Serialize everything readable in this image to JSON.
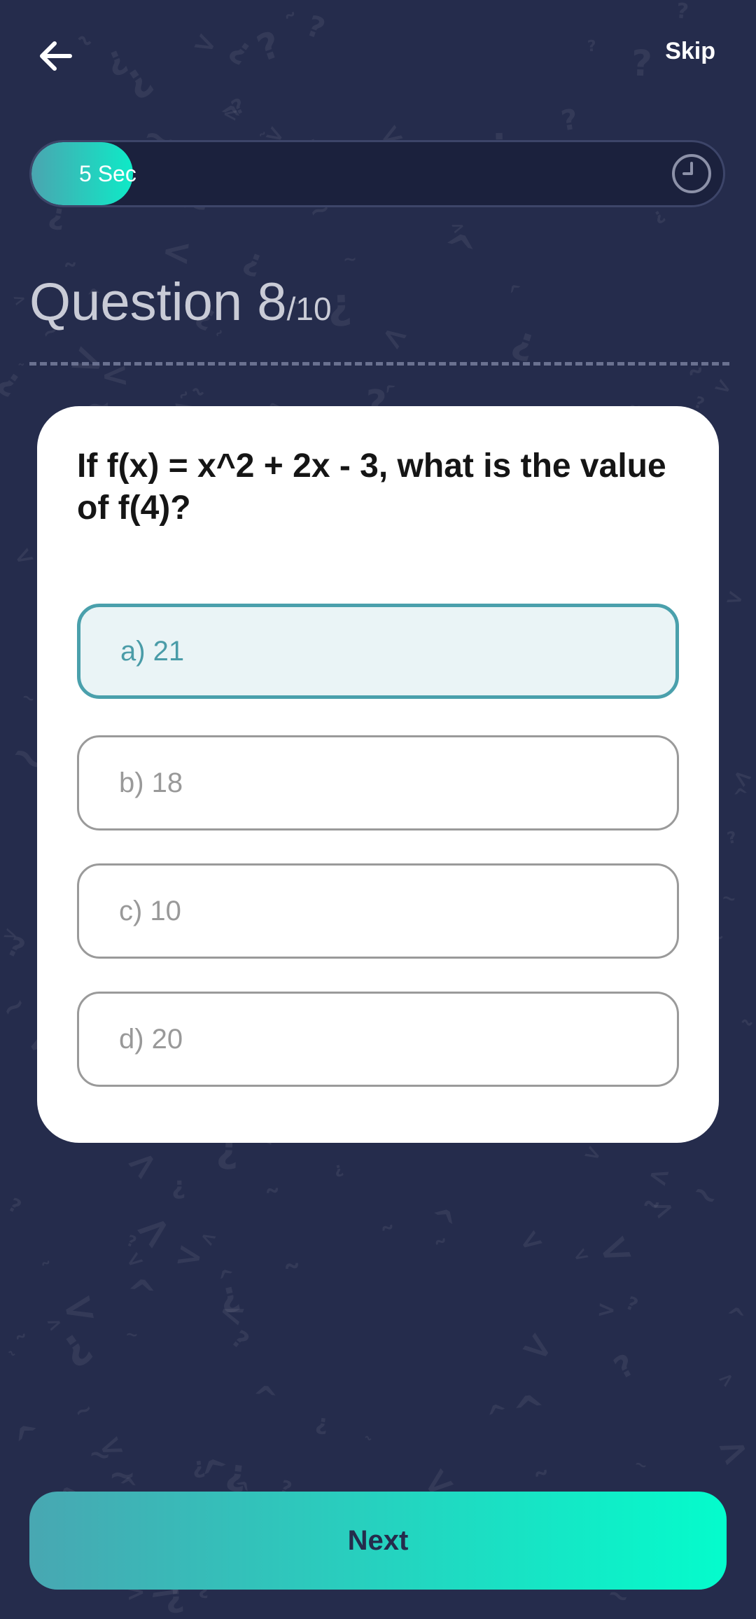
{
  "header": {
    "back_icon": "arrow-left-icon",
    "skip_label": "Skip"
  },
  "timer": {
    "label": "5 Sec",
    "icon": "clock-icon",
    "accent_start": "#4aa5b0",
    "accent_end": "#0eeac7"
  },
  "question": {
    "heading": "Question 8",
    "total": "/10",
    "text": "If f(x) = x^2 + 2x - 3, what is the value of f(4)?"
  },
  "options": [
    {
      "label": "a) 21",
      "selected": true
    },
    {
      "label": "b) 18",
      "selected": false
    },
    {
      "label": "c) 10",
      "selected": false
    },
    {
      "label": "d) 20",
      "selected": false
    }
  ],
  "footer": {
    "next_label": "Next"
  },
  "colors": {
    "background": "#252c4c",
    "selected_border": "#4aa0ac",
    "selected_fill": "#eaf4f6",
    "button_gradient_start": "#48a7b2",
    "button_gradient_end": "#04fccc"
  }
}
